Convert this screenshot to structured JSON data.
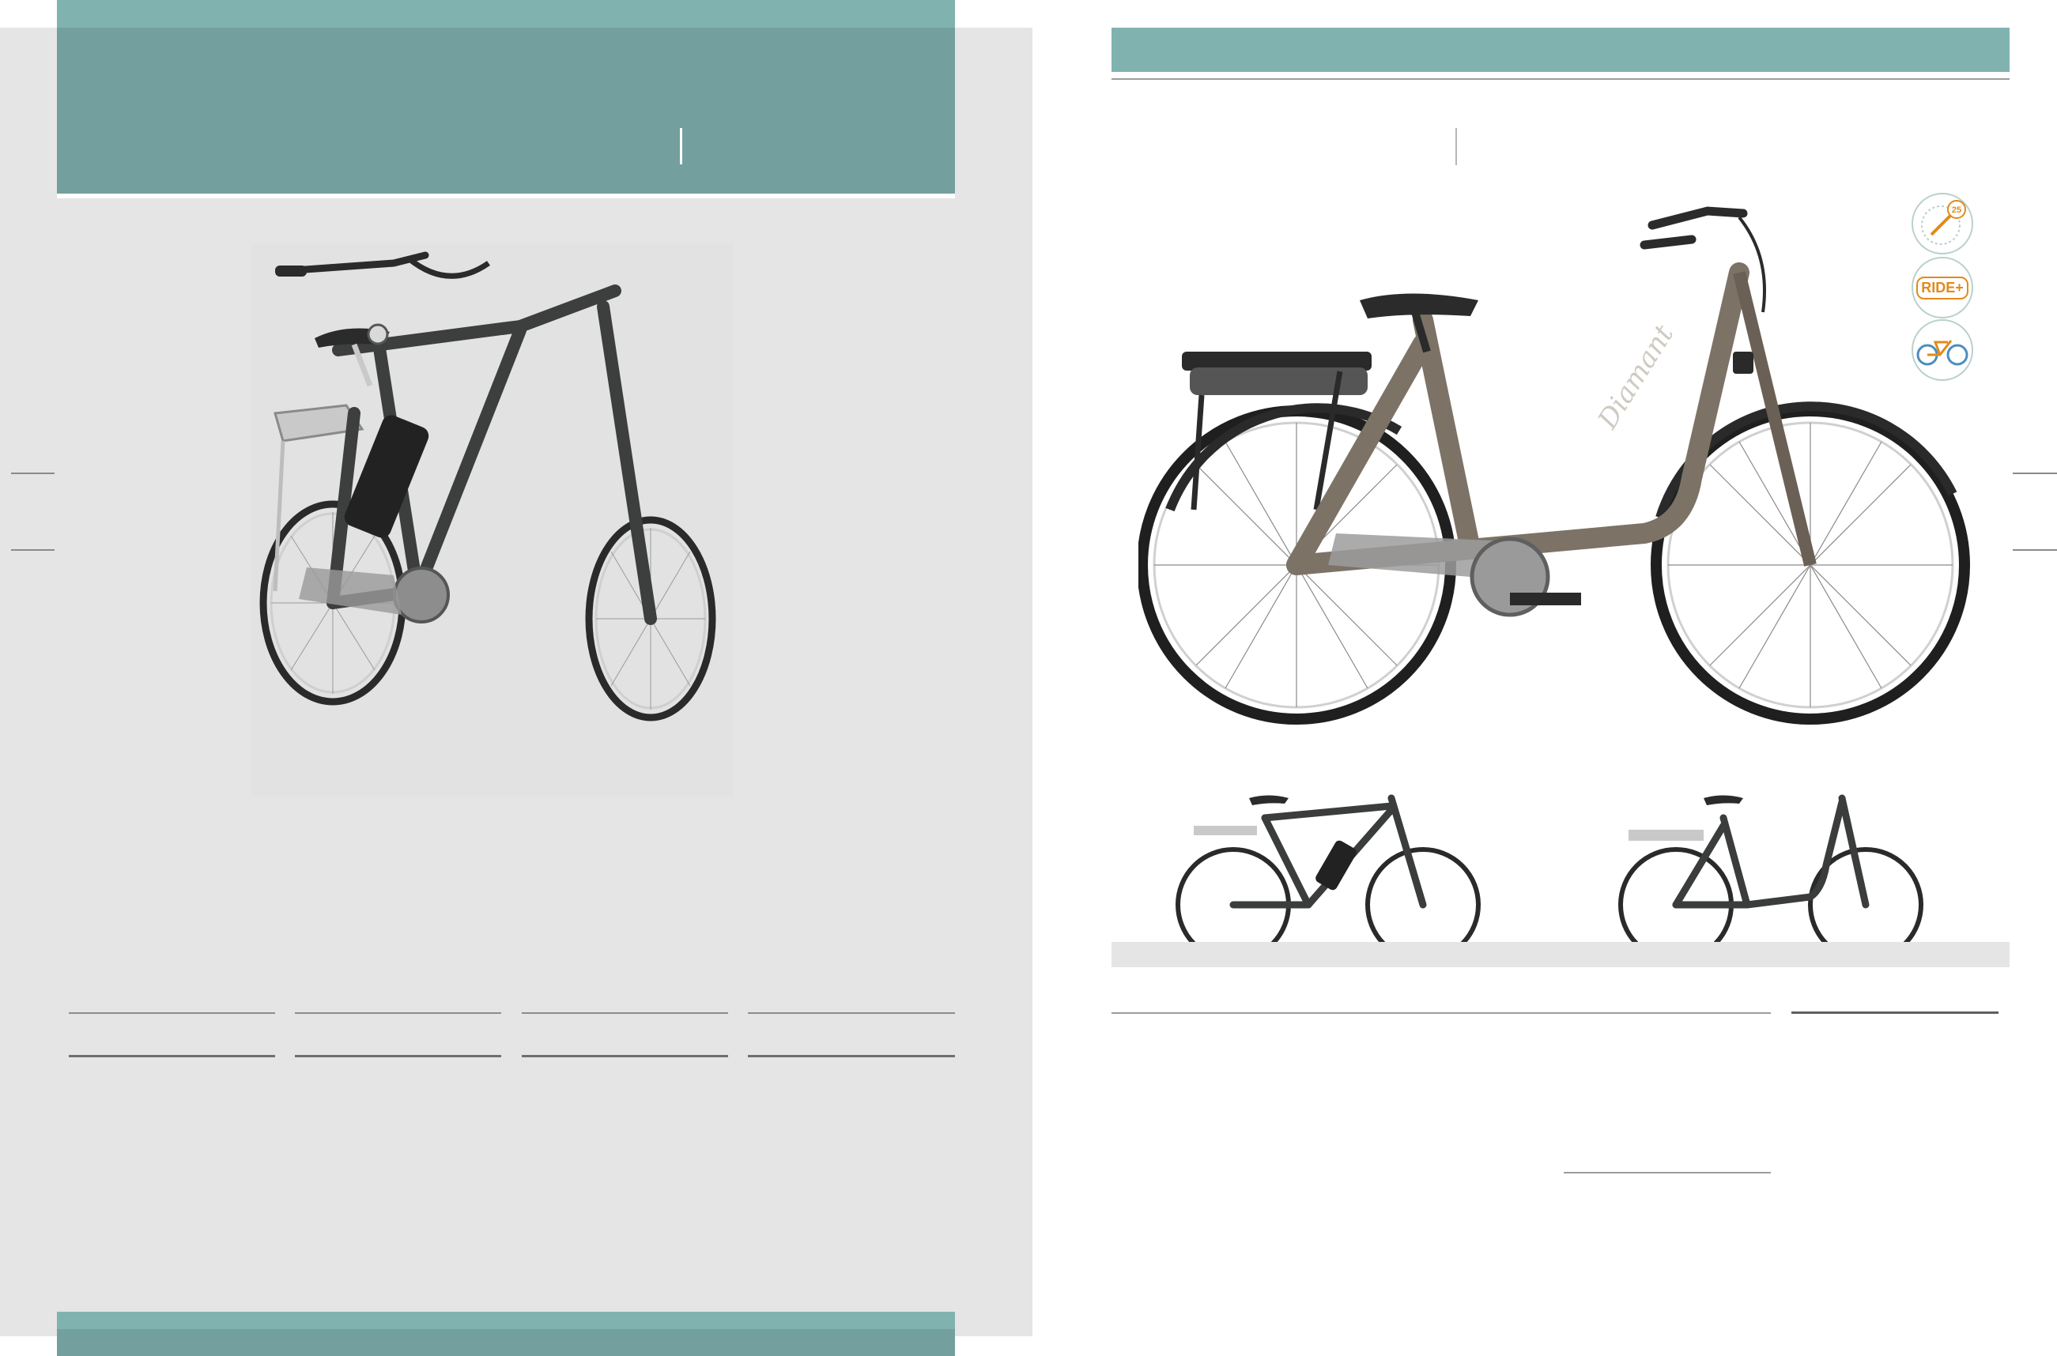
{
  "left_page": {
    "header_color": "#73a09e",
    "panel_color": "#e5e5e6",
    "main_image": "trekking-ebike-anthracite",
    "spec_columns": 4
  },
  "right_page": {
    "header_color": "#80b3b0",
    "main_image": "low-step-ebike-bronze",
    "brand_script": "Diamant",
    "thumbnails": [
      "diamond-frame-ebike",
      "low-step-ebike"
    ],
    "badges": [
      {
        "icon": "speed-25-icon",
        "text": "25"
      },
      {
        "icon": "ride-plus-icon",
        "text": "RIDE+"
      },
      {
        "icon": "bike-frame-icon",
        "text": ""
      }
    ]
  }
}
